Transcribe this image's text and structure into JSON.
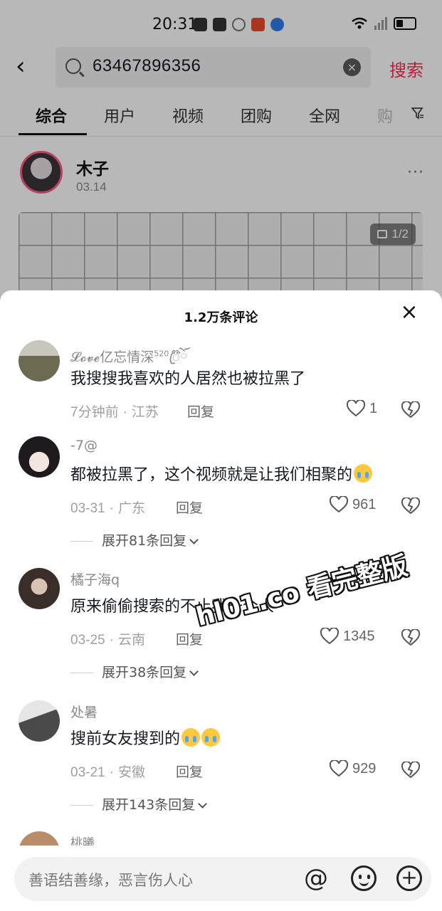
{
  "status_bar": {
    "time": "20:31"
  },
  "search": {
    "back_label": "‹",
    "query": "63467896356",
    "clear_label": "×",
    "submit_label": "搜索"
  },
  "tabs": [
    "综合",
    "用户",
    "视频",
    "团购",
    "全网",
    "购"
  ],
  "post": {
    "author": "木子",
    "date": "03.14",
    "more": "···",
    "image_count": "1/2"
  },
  "comments_sheet": {
    "title": "1.2万条评论",
    "close": "×",
    "comments": [
      {
        "name": "𝓛𝓸𝓿𝓮亿忘情深",
        "name_sup": "520",
        "name_tail": "ꦿ໊ོ",
        "text": "我搜搜我喜欢的人居然也被拉黑了",
        "emojis": 0,
        "time": "7分钟前",
        "location": "江苏",
        "reply": "回复",
        "likes": "1"
      },
      {
        "name": "-7@",
        "text": "都被拉黑了，这个视频就是让我们相聚的",
        "emojis": 1,
        "time": "03-31",
        "location": "广东",
        "reply": "回复",
        "likes": "961",
        "expand": "展开81条回复"
      },
      {
        "name": "橘子海q",
        "text": "原来偷偷搜索的不止我一个人",
        "emojis": 0,
        "time": "03-25",
        "location": "云南",
        "reply": "回复",
        "likes": "1345",
        "expand": "展开38条回复"
      },
      {
        "name": "处暑",
        "text": "搜前女友搜到的",
        "emojis": 2,
        "time": "03-21",
        "location": "安徽",
        "reply": "回复",
        "likes": "929",
        "expand": "展开143条回复"
      },
      {
        "name": "桃曦"
      }
    ]
  },
  "watermark": "hl01.co 看完整版",
  "input_bar": {
    "placeholder": "善语结善缘，恶言伤人心",
    "at": "@"
  },
  "colors": {
    "accent": "#fe2c55",
    "sheet_bg": "#ffffff"
  }
}
